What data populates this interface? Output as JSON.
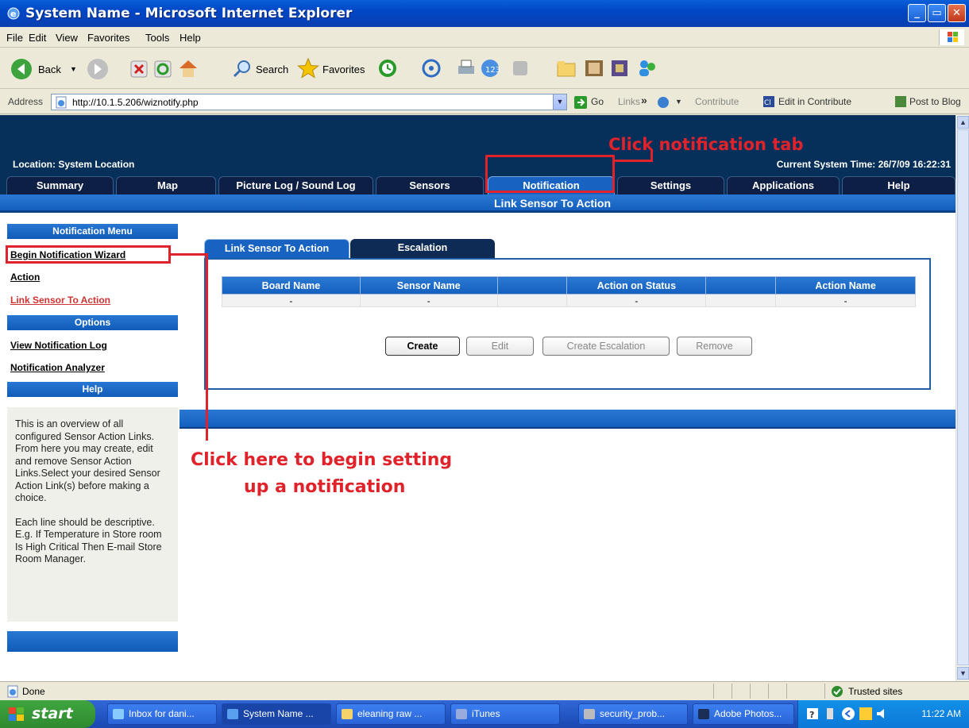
{
  "window": {
    "title": "System Name - Microsoft Internet Explorer"
  },
  "menubar": [
    "File",
    "Edit",
    "View",
    "Favorites",
    "Tools",
    "Help"
  ],
  "toolbar": {
    "back": "Back",
    "search": "Search",
    "favorites": "Favorites"
  },
  "address": {
    "label": "Address",
    "url": "http://10.1.5.206/wiznotify.php",
    "go": "Go",
    "links": "Links",
    "links_chevron": "»",
    "contribute": "Contribute",
    "edit_contribute": "Edit in Contribute",
    "post_blog": "Post to Blog"
  },
  "app": {
    "location": "Location: System Location",
    "time": "Current System Time: 26/7/09 16:22:31",
    "tabs": [
      "Summary",
      "Map",
      "Picture Log / Sound Log",
      "Sensors",
      "Notification",
      "Settings",
      "Applications",
      "Help"
    ],
    "subtitle": "Link Sensor To Action"
  },
  "menu": {
    "head1": "Notification Menu",
    "items1": [
      "Begin Notification Wizard",
      "Action",
      "Link Sensor To Action"
    ],
    "head2": "Options",
    "items2": [
      "View Notification Log",
      "Notification Analyzer"
    ],
    "head3": "Help",
    "help_p1": "This is an overview of all configured Sensor Action Links. From here you may create, edit and remove Sensor Action Links.Select your desired Sensor Action Link(s) before making a choice.",
    "help_p2": "Each line should be descriptive. E.g. If Temperature in Store room Is High Critical Then E-mail Store Room Manager."
  },
  "content": {
    "tabs": [
      "Link Sensor To Action",
      "Escalation"
    ],
    "columns": [
      "Board Name",
      "Sensor Name",
      "",
      "Action on Status",
      "",
      "Action Name"
    ],
    "row": [
      "-",
      "-",
      "",
      "-",
      "",
      "-"
    ],
    "buttons": [
      "Create",
      "Edit",
      "Create Escalation",
      "Remove"
    ]
  },
  "annotations": {
    "tab_hint": "Click notification tab",
    "wizard_hint_1": "Click here to begin setting",
    "wizard_hint_2": "up a notification"
  },
  "status": {
    "done": "Done",
    "zone": "Trusted sites"
  },
  "taskbar": {
    "start": "start",
    "tasks": [
      "Inbox for dani...",
      "System Name ...",
      "eleaning raw ...",
      "iTunes",
      "security_prob...",
      "Adobe Photos..."
    ],
    "clock": "11:22 AM"
  },
  "colors": {
    "banner": "#06305a",
    "accent_blue": "#1863c2",
    "annotation_red": "#e0222a"
  }
}
